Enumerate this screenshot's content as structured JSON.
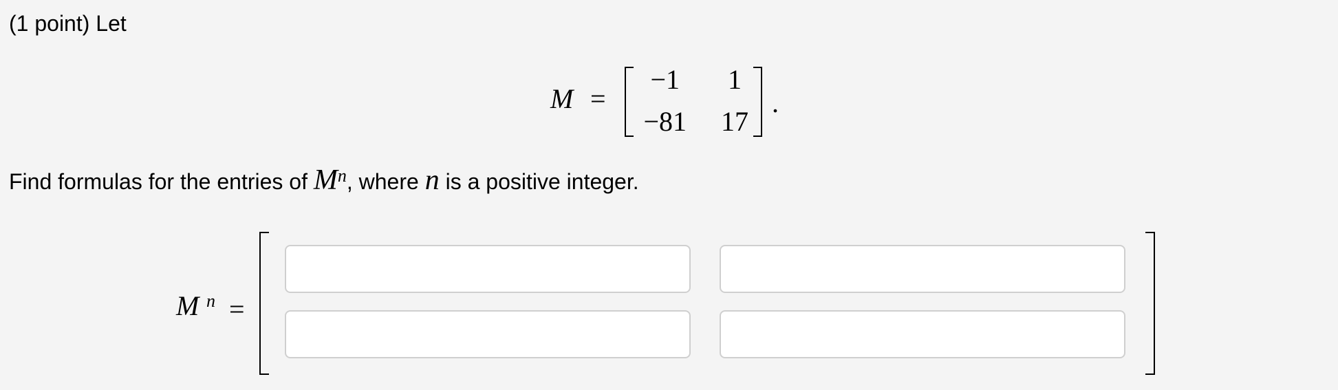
{
  "problem": {
    "header": "(1 point) Let",
    "instruction": {
      "prefix": "Find formulas for the entries of ",
      "var_M": "M",
      "sup_n": "n",
      "middle": ", where ",
      "var_n": "n",
      "suffix": " is a positive integer."
    }
  },
  "matrix_M": {
    "symbol": "M",
    "equals": "=",
    "entries": [
      [
        "−1",
        "1"
      ],
      [
        "−81",
        "17"
      ]
    ],
    "trailing": "."
  },
  "answer": {
    "symbol": "M",
    "power": "n",
    "equals": "=",
    "fields": [
      {
        "value": "",
        "placeholder": ""
      },
      {
        "value": "",
        "placeholder": ""
      },
      {
        "value": "",
        "placeholder": ""
      },
      {
        "value": "",
        "placeholder": ""
      }
    ]
  }
}
